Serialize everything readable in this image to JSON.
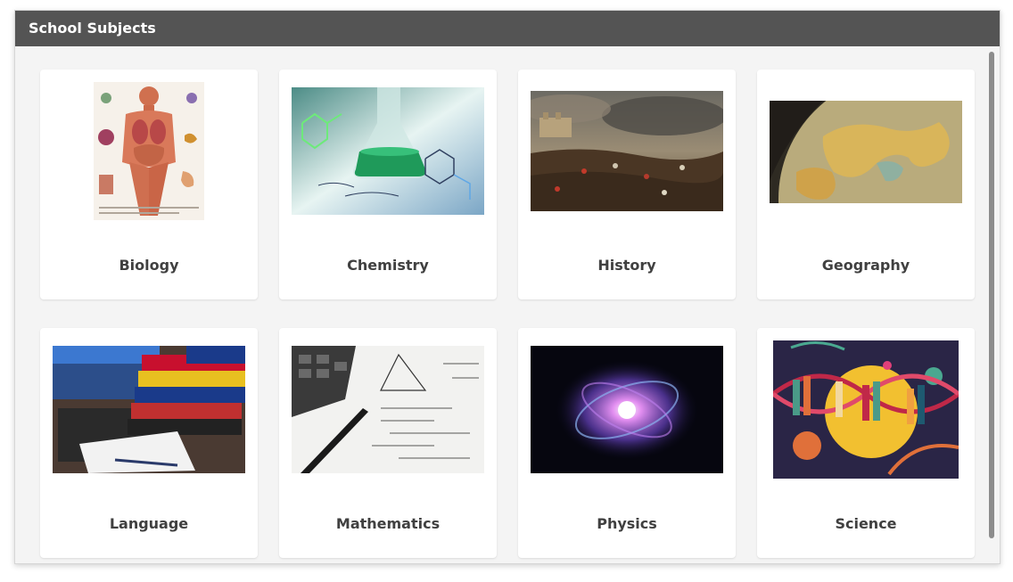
{
  "window": {
    "title": "School Subjects"
  },
  "subjects": [
    {
      "label": "Biology",
      "image": "human-anatomy-illustration"
    },
    {
      "label": "Chemistry",
      "image": "green-flask-molecules"
    },
    {
      "label": "History",
      "image": "battle-painting"
    },
    {
      "label": "Geography",
      "image": "globe-closeup"
    },
    {
      "label": "Language",
      "image": "dictionary-books-laptop"
    },
    {
      "label": "Mathematics",
      "image": "calculator-formulas"
    },
    {
      "label": "Physics",
      "image": "atom-nebula"
    },
    {
      "label": "Science",
      "image": "dna-books-planets"
    }
  ]
}
